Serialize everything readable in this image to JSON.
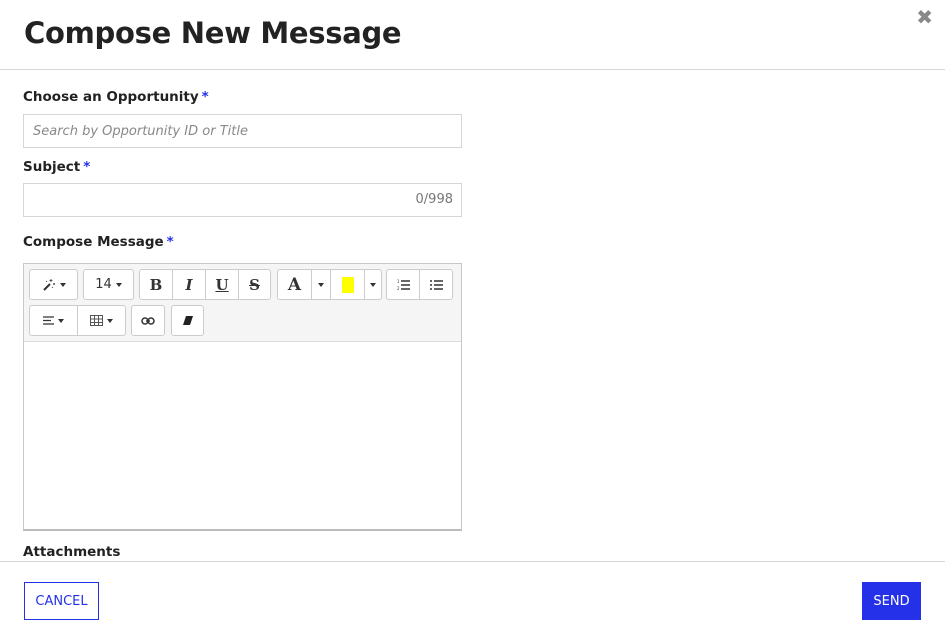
{
  "header": {
    "title": "Compose New Message",
    "close_icon": "close-icon"
  },
  "form": {
    "opportunity": {
      "label": "Choose an Opportunity",
      "required": "*",
      "placeholder": "Search by Opportunity ID or Title",
      "value": ""
    },
    "subject": {
      "label": "Subject",
      "required": "*",
      "value": "",
      "counter": "0/998"
    },
    "message": {
      "label": "Compose Message",
      "required": "*",
      "toolbar": {
        "font_size": "14",
        "buttons": [
          "magic-wand-icon",
          "font-size",
          "bold-icon",
          "italic-icon",
          "underline-icon",
          "strikethrough-icon",
          "font-color-icon",
          "highlight-color-icon",
          "ordered-list-icon",
          "unordered-list-icon",
          "align-icon",
          "table-icon",
          "link-icon",
          "eraser-icon"
        ],
        "bold": "B",
        "italic": "I",
        "underline": "U",
        "strike": "S",
        "font_color": "A",
        "highlight_color": "#ffff00"
      }
    },
    "attachments": {
      "label": "Attachments"
    }
  },
  "footer": {
    "cancel": "CANCEL",
    "send": "SEND"
  },
  "colors": {
    "accent": "#2431e8"
  }
}
